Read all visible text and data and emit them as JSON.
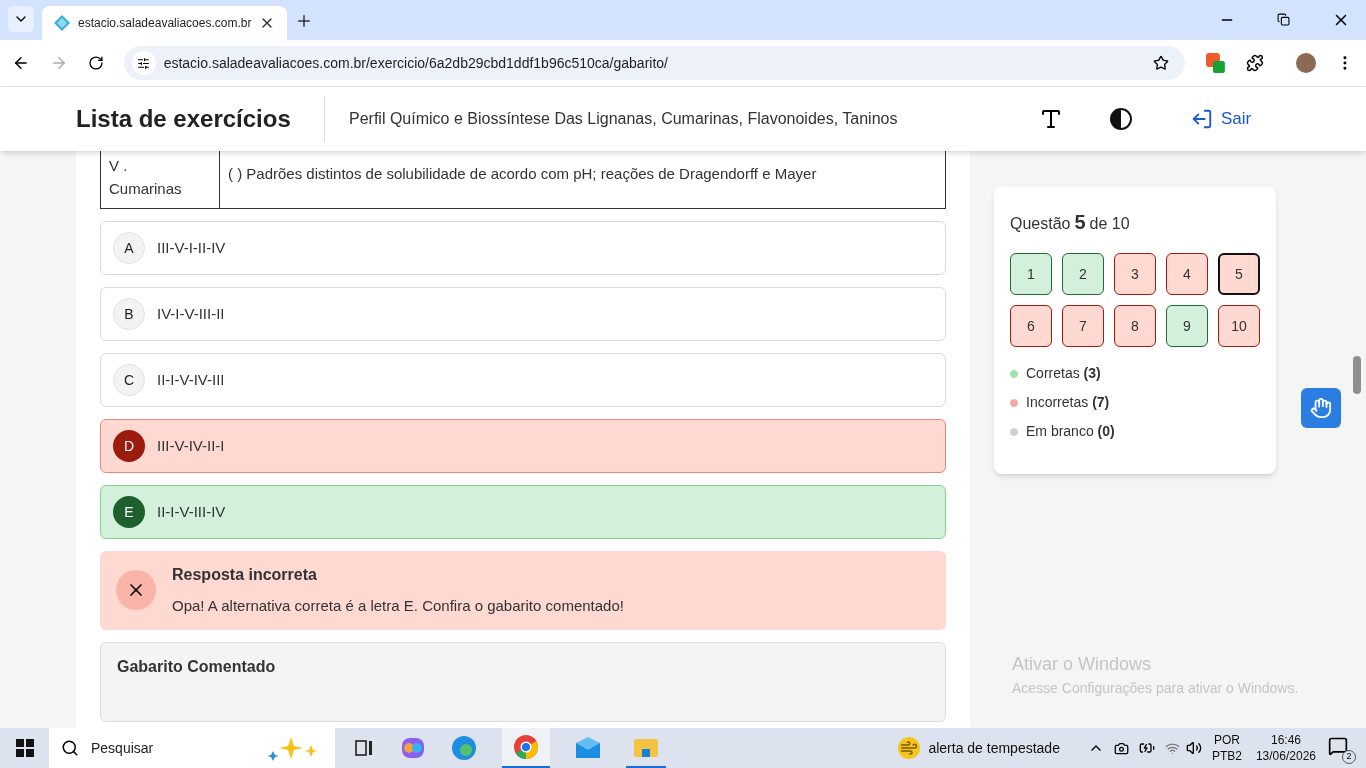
{
  "browser": {
    "tabs": [
      {
        "title": "estacio.saladeavaliacoes.com.br",
        "selected": true
      }
    ],
    "url": "estacio.saladeavaliacoes.com.br/exercicio/6a2db29cbd1ddf1b96c510ca/gabarito/"
  },
  "header": {
    "title": "Lista de exercícios",
    "subtitle": "Perfil Químico e Biossíntese Das Lignanas, Cumarinas, Flavonoides, Taninos",
    "logout": "Sair"
  },
  "table_row": {
    "label_lines": [
      "V .",
      "Cumarinas"
    ],
    "text": "( ) Padrões distintos de solubilidade de acordo com pH; reações de Dragendorff e Mayer"
  },
  "options": [
    {
      "letter": "A",
      "text": "III-V-I-II-IV",
      "kind": "neutral"
    },
    {
      "letter": "B",
      "text": "IV-I-V-III-II",
      "kind": "neutral"
    },
    {
      "letter": "C",
      "text": "II-I-V-IV-III",
      "kind": "neutral"
    },
    {
      "letter": "D",
      "text": "III-V-IV-II-I",
      "kind": "wrong"
    },
    {
      "letter": "E",
      "text": "II-I-V-III-IV",
      "kind": "correct"
    }
  ],
  "feedback": {
    "kind": "incorrect",
    "title": "Resposta incorreta",
    "message": "Opa! A alternativa correta é a letra E. Confira o gabarito comentado!"
  },
  "commented": {
    "title": "Gabarito Comentado"
  },
  "navigator": {
    "prefix": "Questão",
    "current": "5",
    "suffix": "de 10",
    "questions": [
      {
        "number": "1",
        "kind": "correct",
        "selected": false
      },
      {
        "number": "2",
        "kind": "correct",
        "selected": false
      },
      {
        "number": "3",
        "kind": "wrong",
        "selected": false
      },
      {
        "number": "4",
        "kind": "wrong",
        "selected": false
      },
      {
        "number": "5",
        "kind": "wrong",
        "selected": true
      },
      {
        "number": "6",
        "kind": "wrong",
        "selected": false
      },
      {
        "number": "7",
        "kind": "wrong",
        "selected": false
      },
      {
        "number": "8",
        "kind": "wrong",
        "selected": false
      },
      {
        "number": "9",
        "kind": "correct",
        "selected": false
      },
      {
        "number": "10",
        "kind": "wrong",
        "selected": false
      }
    ],
    "legend": [
      {
        "label": "Corretas",
        "count": "(3)",
        "color": "#9be3ad"
      },
      {
        "label": "Incorretas",
        "count": "(7)",
        "color": "#f7aaa0"
      },
      {
        "label": "Em branco",
        "count": "(0)",
        "color": "#cfcfcf"
      }
    ]
  },
  "windows_notice": {
    "title": "Ativar o Windows",
    "message": "Acesse Configurações para ativar o Windows."
  },
  "taskbar": {
    "search_placeholder": "Pesquisar",
    "weather": "alerta de tempestade",
    "language": [
      "POR",
      "PTB2"
    ],
    "time": "16:46",
    "date": "13/06/2026",
    "notifications": "2"
  }
}
